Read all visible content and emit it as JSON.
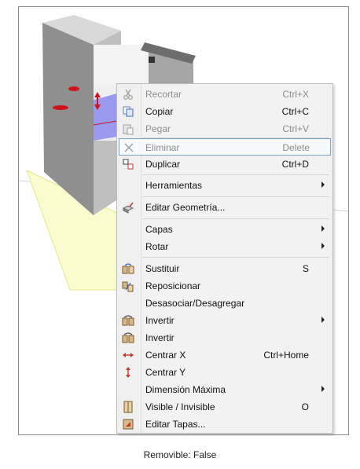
{
  "menu": {
    "items": [
      {
        "label": "Recortar",
        "shortcut": "Ctrl+X",
        "icon": "scissors-icon",
        "disabled": true
      },
      {
        "label": "Copiar",
        "shortcut": "Ctrl+C",
        "icon": "copy-icon"
      },
      {
        "label": "Pegar",
        "shortcut": "Ctrl+V",
        "icon": "paste-icon",
        "disabled": true
      },
      {
        "label": "Eliminar",
        "shortcut": "Delete",
        "icon": "delete-x-icon",
        "disabled": true,
        "focused": true
      },
      {
        "label": "Duplicar",
        "shortcut": "Ctrl+D",
        "icon": "duplicate-icon"
      },
      {
        "label": "Herramientas",
        "submenu": true
      },
      {
        "label": "Editar Geometría...",
        "icon": "edit-geometry-icon"
      },
      {
        "label": "Capas",
        "submenu": true
      },
      {
        "label": "Rotar",
        "submenu": true
      },
      {
        "label": "Sustituir",
        "shortcut": "S",
        "icon": "replace-icon"
      },
      {
        "label": "Reposicionar",
        "icon": "reposition-icon"
      },
      {
        "label": "Desasociar/Desagregar"
      },
      {
        "label": "Invertir",
        "submenu": true,
        "icon": "invert-icon"
      },
      {
        "label": "Invertir",
        "icon": "invert-icon"
      },
      {
        "label": "Centrar X",
        "shortcut": "Ctrl+Home",
        "icon": "center-x-icon"
      },
      {
        "label": "Centrar Y",
        "icon": "center-y-icon"
      },
      {
        "label": "Dimensión Máxima",
        "submenu": true
      },
      {
        "label": "Visible / Invisible",
        "shortcut": "O",
        "icon": "visibility-icon"
      },
      {
        "label": "Editar Tapas...",
        "icon": "edit-covers-icon"
      }
    ]
  },
  "status": {
    "removible": "Removible: False"
  },
  "colors": {
    "menu_bg": "#f2f2f2",
    "focus_border": "#7aa3c9",
    "disabled_text": "#8d8d8d",
    "marker_red": "#d0121b",
    "selection_blue": "#5b5bd6"
  }
}
